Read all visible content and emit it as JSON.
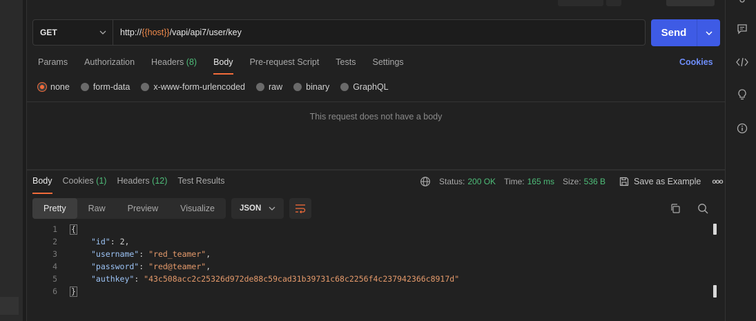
{
  "request": {
    "method": "GET",
    "url_prefix": "http://",
    "url_var": "{{host}}",
    "url_suffix": "/vapi/api7/user/key",
    "send_label": "Send"
  },
  "request_tabs": [
    {
      "label": "Params"
    },
    {
      "label": "Authorization"
    },
    {
      "label": "Headers",
      "count": "(8)"
    },
    {
      "label": "Body",
      "active": true
    },
    {
      "label": "Pre-request Script"
    },
    {
      "label": "Tests"
    },
    {
      "label": "Settings"
    }
  ],
  "cookies_link": "Cookies",
  "body_types": [
    "none",
    "form-data",
    "x-www-form-urlencoded",
    "raw",
    "binary",
    "GraphQL"
  ],
  "selected_body_type": "none",
  "no_body_message": "This request does not have a body",
  "response_tabs": [
    {
      "label": "Body",
      "active": true
    },
    {
      "label": "Cookies",
      "count": "(1)"
    },
    {
      "label": "Headers",
      "count": "(12)"
    },
    {
      "label": "Test Results"
    }
  ],
  "response_meta": {
    "status_label": "Status:",
    "status_value": "200 OK",
    "time_label": "Time:",
    "time_value": "165 ms",
    "size_label": "Size:",
    "size_value": "536 B",
    "save_example": "Save as Example",
    "more": "ooo"
  },
  "view_modes": [
    "Pretty",
    "Raw",
    "Preview",
    "Visualize"
  ],
  "format": "JSON",
  "code_lines": [
    {
      "n": "1",
      "brace": "{"
    },
    {
      "n": "2",
      "key": "\"id\"",
      "val": "2",
      "type": "num",
      "comma": ","
    },
    {
      "n": "3",
      "key": "\"username\"",
      "val": "\"red_teamer\"",
      "type": "str",
      "comma": ","
    },
    {
      "n": "4",
      "key": "\"password\"",
      "val": "\"red@teamer\"",
      "type": "str",
      "comma": ","
    },
    {
      "n": "5",
      "key": "\"authkey\"",
      "val": "\"43c508acc2c25326d972de88c59cad31b39731c68c2256f4c237942366c8917d\"",
      "type": "str",
      "comma": ""
    },
    {
      "n": "6",
      "brace": "}"
    }
  ],
  "icons": {
    "comment": "comment-icon",
    "code": "code-icon",
    "bulb": "lightbulb-icon",
    "info": "info-icon",
    "globe": "globe-icon",
    "save": "save-icon",
    "copy": "copy-icon",
    "search": "search-icon",
    "wrap": "wrap-lines-icon"
  },
  "colors": {
    "accent": "#f26b3a",
    "send": "#3e5be5",
    "success": "#4ebd79",
    "link": "#6e8efb"
  }
}
